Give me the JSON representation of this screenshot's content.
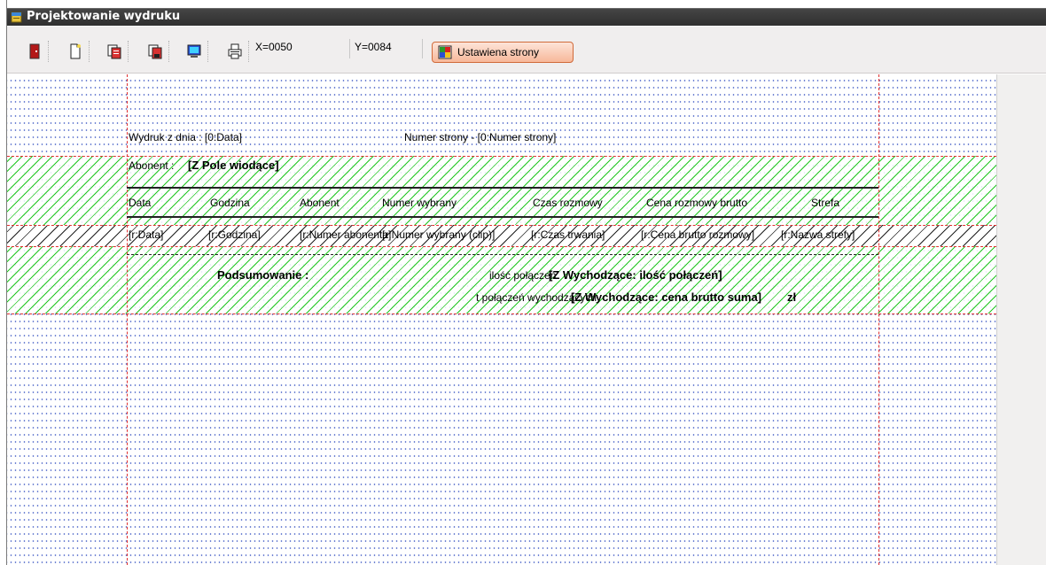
{
  "window": {
    "title": "Projektowanie wydruku"
  },
  "toolbar": {
    "buttons": [
      {
        "icon": "exit-door-icon"
      },
      {
        "icon": "new-page-icon"
      },
      {
        "icon": "open-report-icon"
      },
      {
        "icon": "save-report-icon"
      },
      {
        "icon": "preview-monitor-icon"
      },
      {
        "icon": "print-icon"
      }
    ],
    "x_readout": "X=0050",
    "y_readout": "Y=0084",
    "page_setup_label": "Ustawiena strony"
  },
  "report": {
    "header": {
      "print_date_label": "Wydruk z dnia : [0:Data]",
      "page_number_label": "Numer strony - [0:Numer strony]"
    },
    "group": {
      "subscriber_label": "Abonent :",
      "subscriber_field": "[Z Pole wiodące]"
    },
    "columns": [
      "Data",
      "Godzina",
      "Abonent",
      "Numer wybrany",
      "Czas rozmowy",
      "Cena rozmowy brutto",
      "Strefa"
    ],
    "detail_fields": [
      "[r:Data]",
      "[r:Godzina]",
      "[r:Numer abonenta]",
      "[r:Numer wybrany (clip)]",
      "[r:Czas trwania]",
      "[r:Cena brutto rozmowy]",
      "[r:Nazwa strefy]"
    ],
    "summary": {
      "title": "Podsumowanie :",
      "line1_plain": "ilość połączeń",
      "line1_field": "[Z Wychodzące: ilość połączeń]",
      "line2_plain": "t połączeń wychodzących",
      "line2_field": "[Z Wychodzące: cena brutto suma]",
      "line2_unit": "zł"
    }
  },
  "colors": {
    "title_bar": "#3a3a3a",
    "canvas_dots": "#4a63c8",
    "band_hatch": "#22c722",
    "guide_lines": "#e03030",
    "page_setup_button": "#f7b89a"
  }
}
